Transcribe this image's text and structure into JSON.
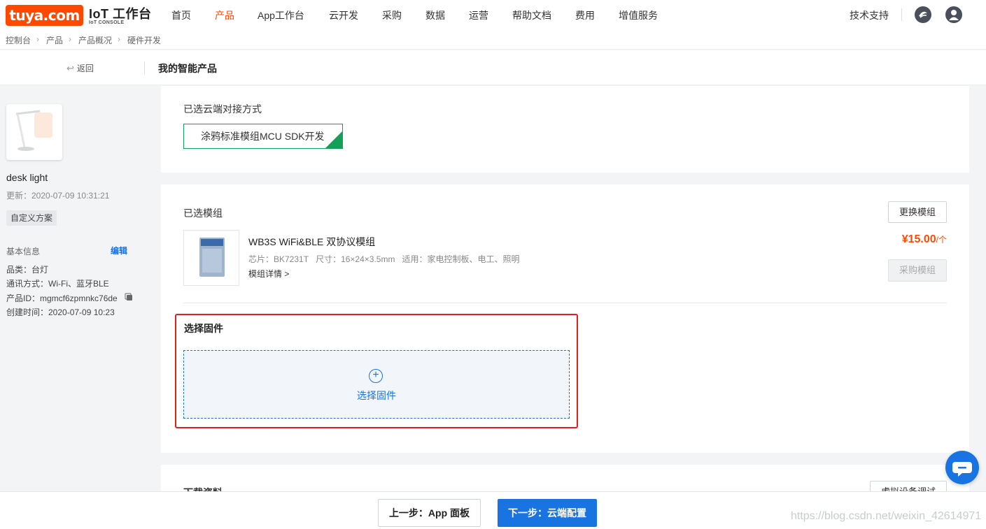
{
  "brand": {
    "logo_text": "tuya.com",
    "console_title": "IoT 工作台",
    "console_sub": "IoT CONSOLE"
  },
  "nav": {
    "items": [
      "首页",
      "产品",
      "App工作台",
      "云开发",
      "采购",
      "数据",
      "运营",
      "帮助文档",
      "费用",
      "增值服务"
    ],
    "active_index": 1,
    "support": "技术支持"
  },
  "breadcrumb": [
    "控制台",
    "产品",
    "产品概况",
    "硬件开发"
  ],
  "subheader": {
    "back_label": "返回",
    "title": "我的智能产品"
  },
  "sidebar": {
    "product_name": "desk light",
    "updated": "更新：2020-07-09 10:31:21",
    "tag": "自定义方案",
    "basic_info_title": "基本信息",
    "edit_label": "编辑",
    "info": [
      "品类：台灯",
      "通讯方式：Wi-Fi、蓝牙BLE",
      "产品ID：mgmcf6zpmnkc76de",
      "创建时间：2020-07-09 10:23"
    ]
  },
  "cloud": {
    "label": "已选云端对接方式",
    "selected": "涂鸦标准模组MCU SDK开发"
  },
  "module": {
    "label": "已选模组",
    "change_button": "更换模组",
    "name": "WB3S WiFi&BLE 双协议模组",
    "chip": "芯片：BK7231T",
    "size": "尺寸：16×24×3.5mm",
    "usage": "适用：家电控制板、电工、照明",
    "detail_link": "模组详情 >",
    "price": "¥15.00",
    "price_unit": "/个",
    "buy_button": "采购模组"
  },
  "firmware": {
    "label": "选择固件",
    "select_text": "选择固件"
  },
  "downloads": {
    "label": "下载资料",
    "virtual_button": "虚拟设备调试"
  },
  "footer": {
    "prev_button": "上一步：App 面板",
    "next_button": "下一步：云端配置",
    "watermark": "https://blog.csdn.net/weixin_42614971"
  },
  "colors": {
    "brand": "#ff4800",
    "primary": "#1874e0",
    "success": "#14a058",
    "highlight": "#e02020"
  }
}
